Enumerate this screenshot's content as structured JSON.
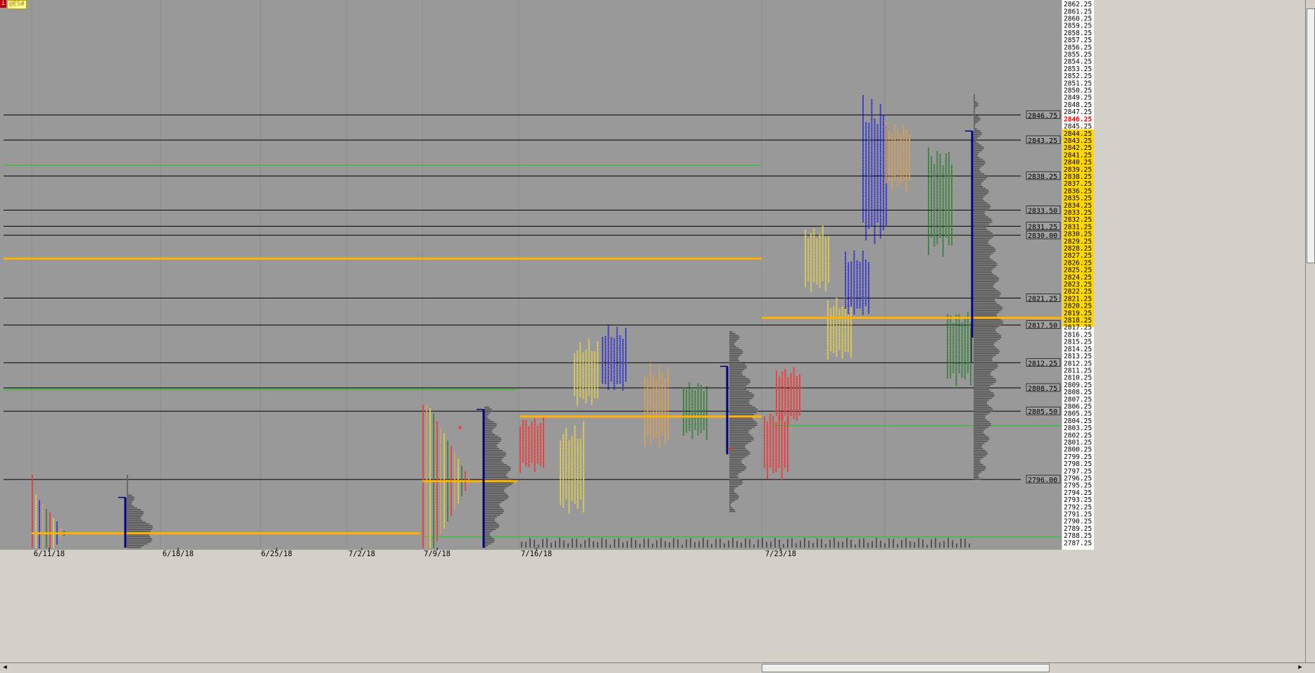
{
  "window": {
    "symbol_badge": "@ES#",
    "info_icon": "i",
    "menu_icon": "M"
  },
  "colors": {
    "background": "#999999",
    "axis_bg": "#ffffff",
    "highlight": "#ffd700",
    "red": "#ff2a2a",
    "yellow": "#e8d24a",
    "blue": "#2b2bd4",
    "orange": "#e0a050",
    "green": "#2e7d32",
    "value_area": "#ffb300",
    "navy": "#000080",
    "vol": "#555555",
    "last_price": "#ff0000"
  },
  "chart_data": {
    "type": "market-profile",
    "y_range": [
      2786.5,
      2862.75
    ],
    "y_tick_step": 0.25,
    "y_labels": [
      "2862.25",
      "2861.25",
      "2860.25",
      "2859.25",
      "2858.25",
      "2857.25",
      "2856.25",
      "2855.25",
      "2854.25",
      "2853.25",
      "2852.25",
      "2851.25",
      "2850.25",
      "2849.25",
      "2848.25",
      "2847.25",
      "2846.25",
      "2845.25",
      "2844.25",
      "2843.25",
      "2842.25",
      "2841.25",
      "2840.25",
      "2839.25",
      "2838.25",
      "2837.25",
      "2836.25",
      "2835.25",
      "2834.25",
      "2833.25",
      "2832.25",
      "2831.25",
      "2830.25",
      "2829.25",
      "2828.25",
      "2827.25",
      "2826.25",
      "2825.25",
      "2824.25",
      "2823.25",
      "2822.25",
      "2821.25",
      "2820.25",
      "2819.25",
      "2818.25",
      "2817.25",
      "2816.25",
      "2815.25",
      "2814.25",
      "2813.25",
      "2812.25",
      "2811.25",
      "2810.25",
      "2809.25",
      "2808.25",
      "2807.25",
      "2806.25",
      "2805.25",
      "2804.25",
      "2803.25",
      "2802.25",
      "2801.25",
      "2800.25",
      "2799.25",
      "2798.25",
      "2797.25",
      "2796.25",
      "2795.25",
      "2794.25",
      "2793.25",
      "2792.25",
      "2791.25",
      "2790.25",
      "2789.25",
      "2788.25",
      "2787.25"
    ],
    "highlight_range": [
      2817.25,
      2844.25
    ],
    "last_price": "2846.25",
    "x_labels": [
      {
        "label": "6/11/18",
        "x": 70
      },
      {
        "label": "6/18/18",
        "x": 253
      },
      {
        "label": "6/25/18",
        "x": 393
      },
      {
        "label": "7/2/18",
        "x": 514
      },
      {
        "label": "7/9/18",
        "x": 621
      },
      {
        "label": "7/16/18",
        "x": 762
      },
      {
        "label": "7/23/18",
        "x": 1109
      }
    ],
    "level_lines": [
      {
        "label": "2846.75",
        "y": 2846.75,
        "color": "#000000"
      },
      {
        "label": "2843.25",
        "y": 2843.25,
        "color": "#000000"
      },
      {
        "label": "2838.25",
        "y": 2838.25,
        "color": "#000000"
      },
      {
        "label": "2833.50",
        "y": 2833.5,
        "color": "#000000"
      },
      {
        "label": "2831.25",
        "y": 2831.25,
        "color": "#000000"
      },
      {
        "label": "2830.00",
        "y": 2830.0,
        "color": "#000000"
      },
      {
        "label": "2821.25",
        "y": 2821.25,
        "color": "#000000"
      },
      {
        "label": "2817.50",
        "y": 2817.5,
        "color": "#000000"
      },
      {
        "label": "2812.25",
        "y": 2812.25,
        "color": "#000000"
      },
      {
        "label": "2808.75",
        "y": 2808.75,
        "color": "#000000"
      },
      {
        "label": "2805.50",
        "y": 2805.5,
        "color": "#000000"
      },
      {
        "label": "2796.00",
        "y": 2796.0,
        "color": "#000000"
      }
    ],
    "poc_lines": [
      {
        "y": 2826.75,
        "x1": 5,
        "x2": 1082
      },
      {
        "y": 2788.5,
        "x1": 45,
        "x2": 597
      },
      {
        "y": 2795.75,
        "x1": 600,
        "x2": 735
      },
      {
        "y": 2804.75,
        "x1": 738,
        "x2": 1082
      },
      {
        "y": 2818.5,
        "x1": 1082,
        "x2": 1508
      }
    ],
    "green_lines": [
      {
        "y": 2839.75,
        "x1": 5,
        "x2": 1080
      },
      {
        "y": 2808.5,
        "x1": 5,
        "x2": 735
      },
      {
        "y": 2803.5,
        "x1": 1100,
        "x2": 1508
      },
      {
        "y": 2788.0,
        "x1": 600,
        "x2": 1508
      }
    ],
    "profiles": [
      {
        "x": 45,
        "low": 2786.5,
        "high": 2796.5,
        "poc": 2788.5,
        "cols": 10,
        "colors": [
          "red",
          "yellow",
          "blue",
          "orange",
          "green"
        ]
      },
      {
        "x": 600,
        "low": 2786.5,
        "high": 2806.25,
        "poc": 2795.75,
        "cols": 14,
        "colors": [
          "red",
          "orange",
          "yellow",
          "green"
        ]
      },
      {
        "x": 1380,
        "low": 2796.0,
        "high": 2849.5,
        "poc": 2818.5,
        "cols": 0,
        "colors": []
      }
    ],
    "tpo_blocks": [
      {
        "x": 738,
        "low": 2797.0,
        "high": 2805.0,
        "color": "red"
      },
      {
        "x": 795,
        "low": 2791.0,
        "high": 2804.0,
        "color": "yellow"
      },
      {
        "x": 815,
        "low": 2806.0,
        "high": 2815.5,
        "color": "yellow"
      },
      {
        "x": 855,
        "low": 2808.0,
        "high": 2817.5,
        "color": "blue"
      },
      {
        "x": 915,
        "low": 2800.0,
        "high": 2812.5,
        "color": "orange"
      },
      {
        "x": 970,
        "low": 2801.5,
        "high": 2810.0,
        "color": "green"
      },
      {
        "x": 1085,
        "low": 2796.0,
        "high": 2806.0,
        "color": "red"
      },
      {
        "x": 1102,
        "low": 2803.5,
        "high": 2812.0,
        "color": "red"
      },
      {
        "x": 1143,
        "low": 2822.0,
        "high": 2831.5,
        "color": "yellow"
      },
      {
        "x": 1175,
        "low": 2812.5,
        "high": 2821.5,
        "color": "yellow"
      },
      {
        "x": 1200,
        "low": 2818.5,
        "high": 2828.0,
        "color": "blue"
      },
      {
        "x": 1225,
        "low": 2828.0,
        "high": 2849.5,
        "color": "blue"
      },
      {
        "x": 1258,
        "low": 2836.0,
        "high": 2846.0,
        "color": "orange"
      },
      {
        "x": 1318,
        "low": 2827.0,
        "high": 2843.0,
        "color": "green"
      },
      {
        "x": 1345,
        "low": 2809.0,
        "high": 2820.0,
        "color": "green"
      }
    ],
    "vol_profiles": [
      {
        "x": 180,
        "low": 2786.5,
        "high": 2796.5,
        "poc": 2788.5
      },
      {
        "x": 688,
        "low": 2786.5,
        "high": 2806.0,
        "poc": 2796.0
      },
      {
        "x": 1036,
        "low": 2791.5,
        "high": 2816.5,
        "poc": 2804.75
      },
      {
        "x": 1383,
        "low": 2796.0,
        "high": 2849.5,
        "poc": 2818.5
      }
    ],
    "range_bars": [
      {
        "x": 178,
        "low": 2786.5,
        "high": 2793.5
      },
      {
        "x": 687,
        "low": 2786.5,
        "high": 2805.75
      },
      {
        "x": 1033,
        "low": 2799.5,
        "high": 2811.75
      },
      {
        "x": 1381,
        "low": 2815.75,
        "high": 2844.5
      }
    ],
    "day_separators": [
      45,
      228,
      370,
      493,
      600,
      737,
      1082,
      1257
    ],
    "grid": true
  }
}
